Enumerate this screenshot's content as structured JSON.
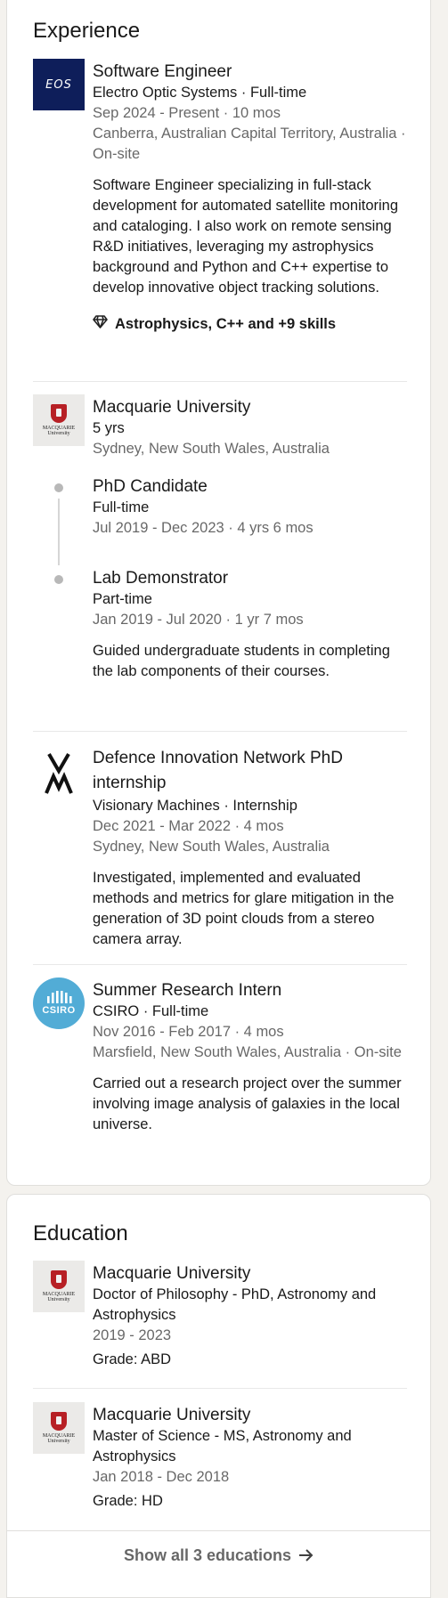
{
  "experience": {
    "heading": "Experience",
    "items": [
      {
        "title": "Software Engineer",
        "company_line": "Electro Optic Systems · Full-time",
        "dates": "Sep 2024 - Present · 10 mos",
        "location": "Canberra, Australian Capital Territory, Australia · On-site",
        "description": "Software Engineer specializing in full-stack development for automated satellite monitoring and cataloging. I also work on remote sensing R&D initiatives, leveraging my astrophysics background and Python and C++ expertise to develop innovative object tracking solutions.",
        "skills": "Astrophysics, C++ and +9 skills",
        "logo_text": "EOS"
      },
      {
        "company": "Macquarie University",
        "duration": "5 yrs",
        "location": "Sydney, New South Wales, Australia",
        "roles": [
          {
            "title": "PhD Candidate",
            "type": "Full-time",
            "dates": "Jul 2019 - Dec 2023 · 4 yrs 6 mos"
          },
          {
            "title": "Lab Demonstrator",
            "type": "Part-time",
            "dates": "Jan 2019 - Jul 2020 · 1 yr 7 mos",
            "description": "Guided undergraduate students in completing the lab components of their courses."
          }
        ]
      },
      {
        "title": "Defence Innovation Network PhD internship",
        "company_line": "Visionary Machines · Internship",
        "dates": "Dec 2021 - Mar 2022 · 4 mos",
        "location": "Sydney, New South Wales, Australia",
        "description": "Investigated, implemented and evaluated methods and metrics for glare mitigation in the generation of 3D point clouds from a stereo camera array."
      },
      {
        "title": "Summer Research Intern",
        "company_line": "CSIRO · Full-time",
        "dates": "Nov 2016 - Feb 2017 · 4 mos",
        "location": "Marsfield, New South Wales, Australia · On-site",
        "description": "Carried out a research project over the summer involving image analysis of galaxies in the local universe.",
        "logo_text": "CSIRO"
      }
    ]
  },
  "education": {
    "heading": "Education",
    "items": [
      {
        "school": "Macquarie University",
        "degree": "Doctor of Philosophy - PhD, Astronomy and Astrophysics",
        "dates": "2019 - 2023",
        "grade": "Grade: ABD"
      },
      {
        "school": "Macquarie University",
        "degree": "Master of Science - MS, Astronomy and Astrophysics",
        "dates": "Jan 2018 - Dec 2018",
        "grade": "Grade: HD"
      }
    ],
    "show_all": "Show all 3 educations"
  },
  "logos": {
    "macquarie_line1": "MACQUARIE",
    "macquarie_line2": "University"
  },
  "icons": {
    "skills": "diamond-icon",
    "arrow": "arrow-right-icon"
  },
  "colors": {
    "eos_bg": "#0e1e5a",
    "csiro_bg": "#52acd6",
    "macquarie_red": "#b72025",
    "page_bg": "#f4f2ee"
  }
}
